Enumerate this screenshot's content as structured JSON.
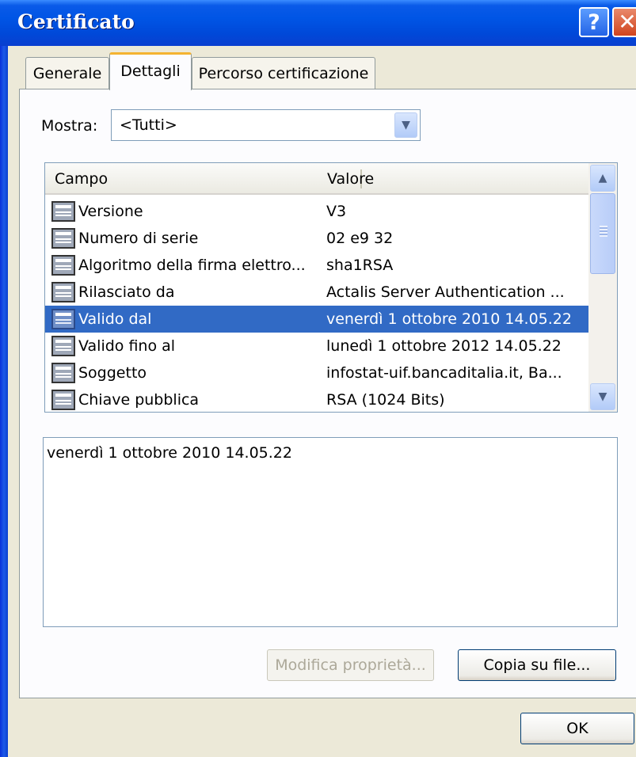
{
  "window": {
    "title": "Certificato",
    "help_label": "?",
    "close_label": "✕"
  },
  "tabs": [
    {
      "label": "Generale"
    },
    {
      "label": "Dettagli"
    },
    {
      "label": "Percorso certificazione"
    }
  ],
  "filter": {
    "label": "Mostra:",
    "selected": "<Tutti>"
  },
  "list": {
    "columns": [
      "Campo",
      "Valore"
    ],
    "rows": [
      {
        "field": "Versione",
        "value": "V3"
      },
      {
        "field": "Numero di serie",
        "value": "02 e9 32"
      },
      {
        "field": "Algoritmo della firma elettro...",
        "value": "sha1RSA"
      },
      {
        "field": "Rilasciato da",
        "value": "Actalis Server Authentication ..."
      },
      {
        "field": "Valido dal",
        "value": "venerdì 1 ottobre 2010 14.05.22"
      },
      {
        "field": "Valido fino al",
        "value": "lunedì 1 ottobre 2012 14.05.22"
      },
      {
        "field": "Soggetto",
        "value": "infostat-uif.bancaditalia.it, Ba..."
      },
      {
        "field": "Chiave pubblica",
        "value": "RSA (1024 Bits)"
      }
    ],
    "selected_index": 4
  },
  "detail": {
    "text": "venerdì 1 ottobre 2010 14.05.22"
  },
  "buttons": {
    "edit_properties": "Modifica proprietà...",
    "copy_to_file": "Copia su file...",
    "ok": "OK"
  },
  "icons": {
    "row": "certificate-field-icon",
    "combo_arrow": "chevron-down-icon",
    "scroll_up": "chevron-up-icon",
    "scroll_down": "chevron-down-icon",
    "help": "help-icon",
    "close": "close-icon"
  }
}
